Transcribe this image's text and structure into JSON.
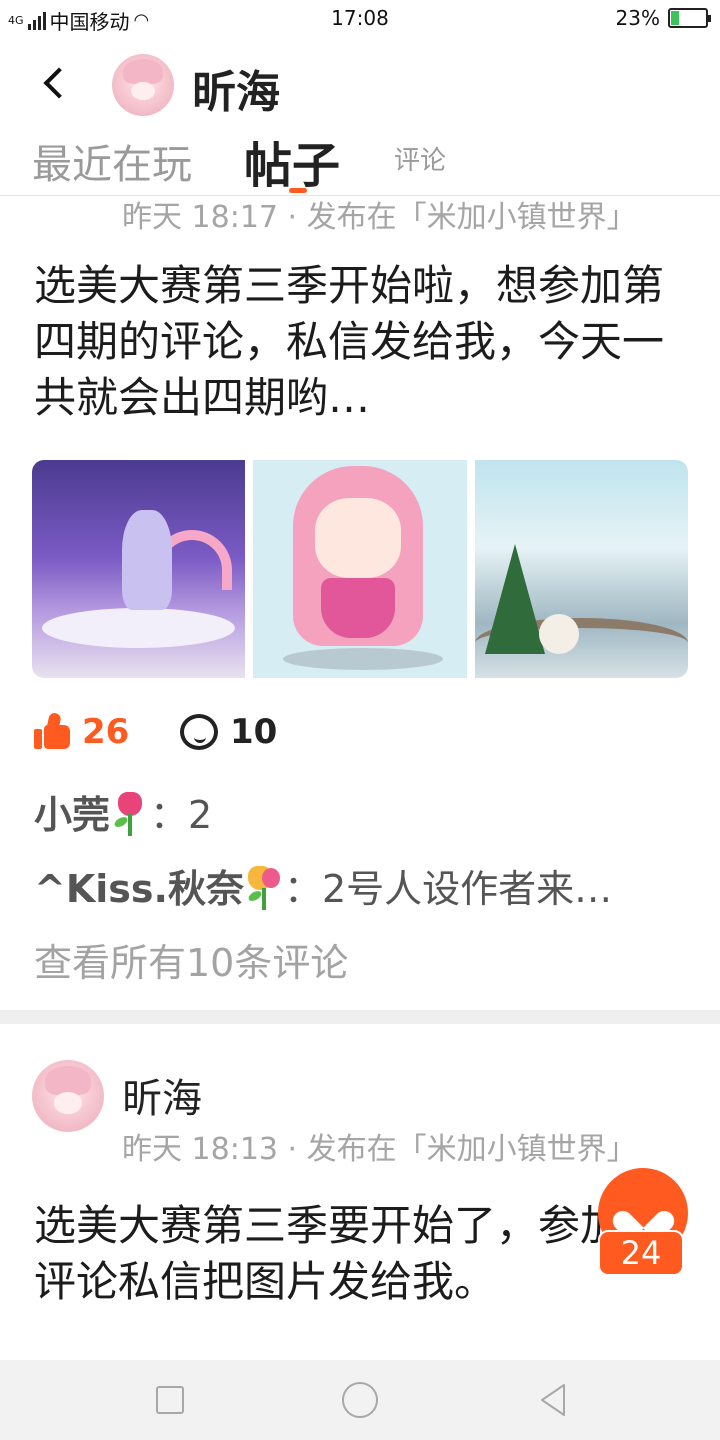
{
  "status_bar": {
    "network": "4G",
    "carrier": "中国移动",
    "time": "17:08",
    "battery": "23%",
    "battery_level": 0.23
  },
  "header": {
    "title": "昕海"
  },
  "tabs": [
    {
      "label": "最近在玩"
    },
    {
      "label": "帖子"
    },
    {
      "label": "评论"
    }
  ],
  "post1": {
    "meta": "昨天 18:17 · 发布在「米加小镇世界」",
    "text": "选美大赛第三季开始啦，想参加第四期的评论，私信发给我，今天一共就会出四期哟…",
    "likes": "26",
    "comments": "10",
    "comment_list": [
      {
        "author": "小莞",
        "sep": "：",
        "text": "2"
      },
      {
        "author": "^Kiss.秋奈",
        "sep": "：",
        "text": "2号人设作者来…"
      }
    ],
    "view_all": "查看所有10条评论"
  },
  "post2": {
    "author": "昕海",
    "meta": "昨天 18:13 · 发布在「米加小镇世界」",
    "text": "选美大赛第三季要开始了，参加的评论私信把图片发给我。"
  },
  "fab": {
    "count": "24"
  },
  "colors": {
    "accent": "#ff5a1f",
    "muted": "#a5a5a5",
    "separator": "#efefef"
  },
  "icons": [
    "back-icon",
    "thumbs-up-icon",
    "comment-bubble-icon",
    "heart-icon",
    "nav-recent-icon",
    "nav-home-icon",
    "nav-back-icon"
  ]
}
